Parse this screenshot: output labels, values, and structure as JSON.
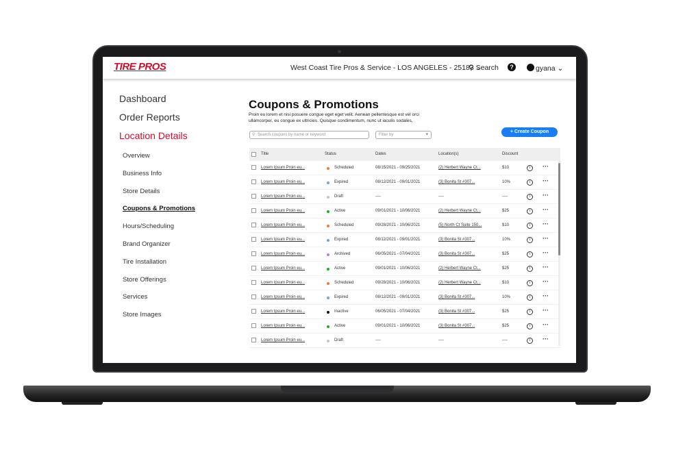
{
  "header": {
    "logo": "TIRE PROS",
    "location": "West Coast Tire Pros & Service - LOS ANGELES - 25183",
    "search": "Search",
    "user": "gyana"
  },
  "sidebar": {
    "main": [
      {
        "label": "Dashboard"
      },
      {
        "label": "Order Reports"
      },
      {
        "label": "Location Details",
        "active": true
      }
    ],
    "sub": [
      {
        "label": "Overview"
      },
      {
        "label": "Business Info"
      },
      {
        "label": "Store Details"
      },
      {
        "label": "Coupons & Promotions",
        "active": true
      },
      {
        "label": "Hours/Scheduling"
      },
      {
        "label": "Brand Organizer"
      },
      {
        "label": "Tire Installation"
      },
      {
        "label": "Store Offerings"
      },
      {
        "label": "Services"
      },
      {
        "label": "Store Images"
      }
    ]
  },
  "page": {
    "title": "Coupons & Promotions",
    "description": "Proin eu lorem et nisi posuere congue eget eget velit. Aenean pellentesque est vel orci ullamcorper, eu congue ex ultricies. Quisque condimentum, nunc ut iaculis sodales,",
    "search_placeholder": "Search coupons by name or keyword",
    "filter_placeholder": "Filter by",
    "create_label": "+ Create Coupon"
  },
  "colors": {
    "accent": "#1a7ef2",
    "active_nav": "#c8102e",
    "Scheduled": "#f47a30",
    "Expired": "#6aa5e0",
    "Draft": "#c4c4c4",
    "Active": "#1bb21b",
    "Archived": "#b77df0",
    "Inactive": "#111111"
  },
  "table": {
    "columns": [
      "Title",
      "Status",
      "Dates",
      "Location(s)",
      "Discount"
    ],
    "rows": [
      {
        "title": "Lorem Ipsum Proin eu...",
        "status": "Scheduled",
        "dates": "08/15/2021 - 09/25/2021",
        "location": "(2) Herbert Wayne Ct...",
        "discount": "$10"
      },
      {
        "title": "Lorem Ipsum Proin eu...",
        "status": "Expired",
        "dates": "08/12/2021 - 09/01/2021",
        "location": "(3) Bonita St #307...",
        "discount": "10%"
      },
      {
        "title": "Lorem Ipsum Proin eu...",
        "status": "Draft",
        "dates": "----",
        "location": "----",
        "discount": "----"
      },
      {
        "title": "Lorem Ipsum Proin eu...",
        "status": "Active",
        "dates": "09/01/2021 - 10/06/2021",
        "location": "(2) Herbert Wayne Ct...",
        "discount": "$25"
      },
      {
        "title": "Lorem Ipsum Proin eu...",
        "status": "Scheduled",
        "dates": "09/28/2021 - 10/06/2021",
        "location": "(5) North Ct Suite 150...",
        "discount": "$10"
      },
      {
        "title": "Lorem Ipsum Proin eu...",
        "status": "Expired",
        "dates": "08/12/2021 - 09/01/2021",
        "location": "(3) Bonita St #307...",
        "discount": "10%"
      },
      {
        "title": "Lorem Ipsum Proin eu...",
        "status": "Archived",
        "dates": "06/05/2021 - 07/04/2021",
        "location": "(3) Bonita St #307...",
        "discount": "$25"
      },
      {
        "title": "Lorem Ipsum Proin eu...",
        "status": "Active",
        "dates": "09/01/2021 - 10/06/2021",
        "location": "(2) Herbert Wayne Ct...",
        "discount": "$25"
      },
      {
        "title": "Lorem Ipsum Proin eu...",
        "status": "Scheduled",
        "dates": "09/28/2021 - 10/06/2021",
        "location": "(2) Herbert Wayne Ct...",
        "discount": "$10"
      },
      {
        "title": "Lorem Ipsum Proin eu...",
        "status": "Expired",
        "dates": "08/12/2021 - 09/01/2021",
        "location": "(3) Bonita St #307...",
        "discount": "10%"
      },
      {
        "title": "Lorem Ipsum Proin eu...",
        "status": "Inactive",
        "dates": "06/05/2021 - 07/04/2021",
        "location": "(3) Bonita St #307...",
        "discount": "$25"
      },
      {
        "title": "Lorem Ipsum Proin eu...",
        "status": "Active",
        "dates": "09/01/2021 - 10/06/2021",
        "location": "(3) Bonita St #307...",
        "discount": "$25"
      },
      {
        "title": "Lorem Ipsum Proin eu...",
        "status": "Draft",
        "dates": "----",
        "location": "----",
        "discount": "----"
      }
    ]
  }
}
